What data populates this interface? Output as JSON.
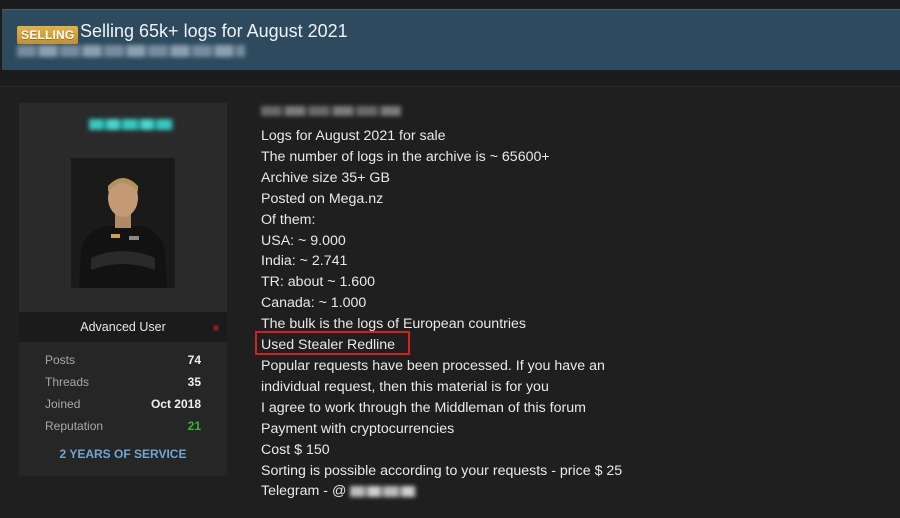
{
  "thread": {
    "prefix": "SELLING",
    "title": "Selling 65k+ logs for August 2021"
  },
  "user": {
    "rank": "Advanced User",
    "stats": [
      {
        "label": "Posts",
        "value": "74"
      },
      {
        "label": "Threads",
        "value": "35"
      },
      {
        "label": "Joined",
        "value": "Oct 2018"
      },
      {
        "label": "Reputation",
        "value": "21"
      }
    ],
    "service_badge": "2 YEARS OF SERVICE"
  },
  "post": {
    "lines": [
      "Logs for August 2021 for sale",
      "The number of logs in the archive is ~ 65600+",
      "Archive size 35+ GB",
      "Posted on Mega.nz",
      "Of them:",
      "USA:  ~ 9.000",
      "India: ~ 2.741",
      "TR: about ~ 1.600",
      "Canada: ~ 1.000",
      "The bulk is the logs of European countries",
      "Used Stealer Redline",
      "Popular requests have been processed. If you have an",
      "individual request, then this material is for you",
      "I agree to work through the Middleman of this forum",
      "Payment with cryptocurrencies",
      "Cost $ 150",
      "Sorting is possible according to your requests - price $ 25"
    ],
    "telegram_prefix": "Telegram - @"
  },
  "colors": {
    "header_bg": "#2e4a5e",
    "prefix_badge": "#d9a53a",
    "reputation_green": "#3ab43a",
    "service_blue": "#6fa6d4",
    "highlight_red": "#d62020"
  }
}
